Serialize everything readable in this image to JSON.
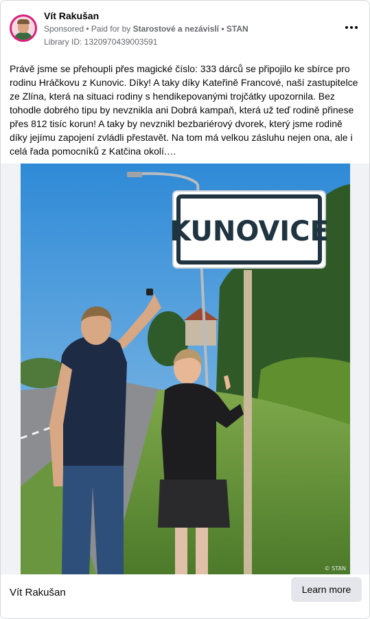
{
  "post": {
    "page_name": "Vít Rakušan",
    "sponsored_label": "Sponsored",
    "paid_for_prefix": " • Paid for by ",
    "paid_for_name": "Starostové a nezávislí • STAN",
    "library_id": "Library ID: 1320970439003591",
    "more_icon": "more-horizontal-icon",
    "body_text": "Právě jsme se přehoupli přes magické číslo: 333 dárců se připojilo ke sbírce pro rodinu Hráčkovu z Kunovic. Díky! A taky díky Kateřině Francové, naší zastupitelce ze Zlína, která na situaci rodiny s hendikepovanými trojčátky upozornila. Bez tohodle dobrého tipu by nevznikla ani Dobrá kampaň, která už teď rodině přinese přes 812 tisíc korun! A taky by nevznikl bezbariérový dvorek, který jsme rodině díky jejímu zapojení zvládli přestavět. Na tom má velkou zásluhu nejen ona, ale i celá řada pomocníků z Katčina okolí.…"
  },
  "photo": {
    "sign_text": "KUNOVICE",
    "watermark": "© STAN"
  },
  "footer": {
    "page_name": "Vít Rakušan",
    "cta_label": "Learn more"
  },
  "colors": {
    "avatar_ring": "#d81f7a",
    "sky": "#2f8ad6",
    "sign_border": "#1f3440"
  }
}
